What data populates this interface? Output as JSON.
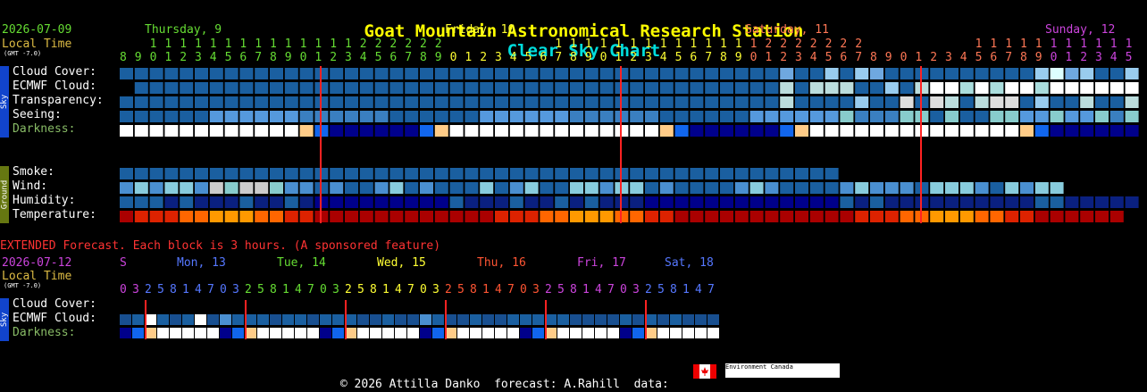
{
  "title": {
    "station": "Goat Mountain Astronomical Research Station",
    "chart": "Clear Sky Chart"
  },
  "main": {
    "date": "2026-07-09",
    "local_time": "Local Time",
    "gmt": "(GMT -7.0)",
    "days": [
      {
        "label": "Thursday, 9",
        "color": "#66dd33"
      },
      {
        "label": "Friday, 10",
        "color": "#ffff33"
      },
      {
        "label": "Saturday, 11",
        "color": "#ff7755"
      },
      {
        "label": "Sunday, 12",
        "color": "#cc44dd"
      }
    ],
    "hours": "89012345678901234567890123456789012345678901234567890123456789012345678901234567890123456789012345678901234567",
    "tens": "  11111111111111222222       111111111111112222222       11111111111111222222       1111111"
  },
  "sky_rows": [
    "Cloud Cover:",
    "ECMWF Cloud:",
    "Transparency:",
    "Seeing:",
    "Darkness:"
  ],
  "ground_rows": [
    "Smoke:",
    "Wind:",
    "Humidity:",
    "Temperature:"
  ],
  "side_labels": {
    "sky": "Sky",
    "ground": "Ground"
  },
  "extended": {
    "note": "EXTENDED Forecast. Each block is 3 hours. (A sponsored feature)",
    "date": "2026-07-12",
    "local_time": "Local Time",
    "gmt": "(GMT -7.0)",
    "days": [
      {
        "label": "S",
        "color": "#cc44dd"
      },
      {
        "label": "Mon, 13",
        "color": "#5577ff"
      },
      {
        "label": "Tue, 14",
        "color": "#66dd33"
      },
      {
        "label": "Wed, 15",
        "color": "#ffff33"
      },
      {
        "label": "Thu, 16",
        "color": "#ff5533"
      },
      {
        "label": "Fri, 17",
        "color": "#cc44dd"
      },
      {
        "label": "Sat, 18",
        "color": "#5577ff"
      }
    ],
    "tens": "22     1 1 1 2 2     1 1 1 2 2     1 1 1 2 2     1 1 1 2 2     1 1 1 2 2     1 1 1",
    "hours": "0 3 2 5 8 1 4 7 0 3 2 5 8 1 4 7 0 3 2 5 8 1 4 7 0 3 2 5 8 1 4 7 0 3 2 5 8 1 4 7 0 3 2 5 8 1 4 7",
    "rows": [
      "Cloud Cover:",
      "ECMWF Cloud:",
      "Darkness:"
    ]
  },
  "footer": {
    "text": "© 2026 Attilla Danko  forecast: A.Rahill  data:",
    "flag_text": "Environment Canada"
  },
  "colors": {
    "cloud": "#1a5fa0",
    "dark": "#00008b",
    "temp_hot": "#ff3300",
    "divider": "#ff2222"
  }
}
